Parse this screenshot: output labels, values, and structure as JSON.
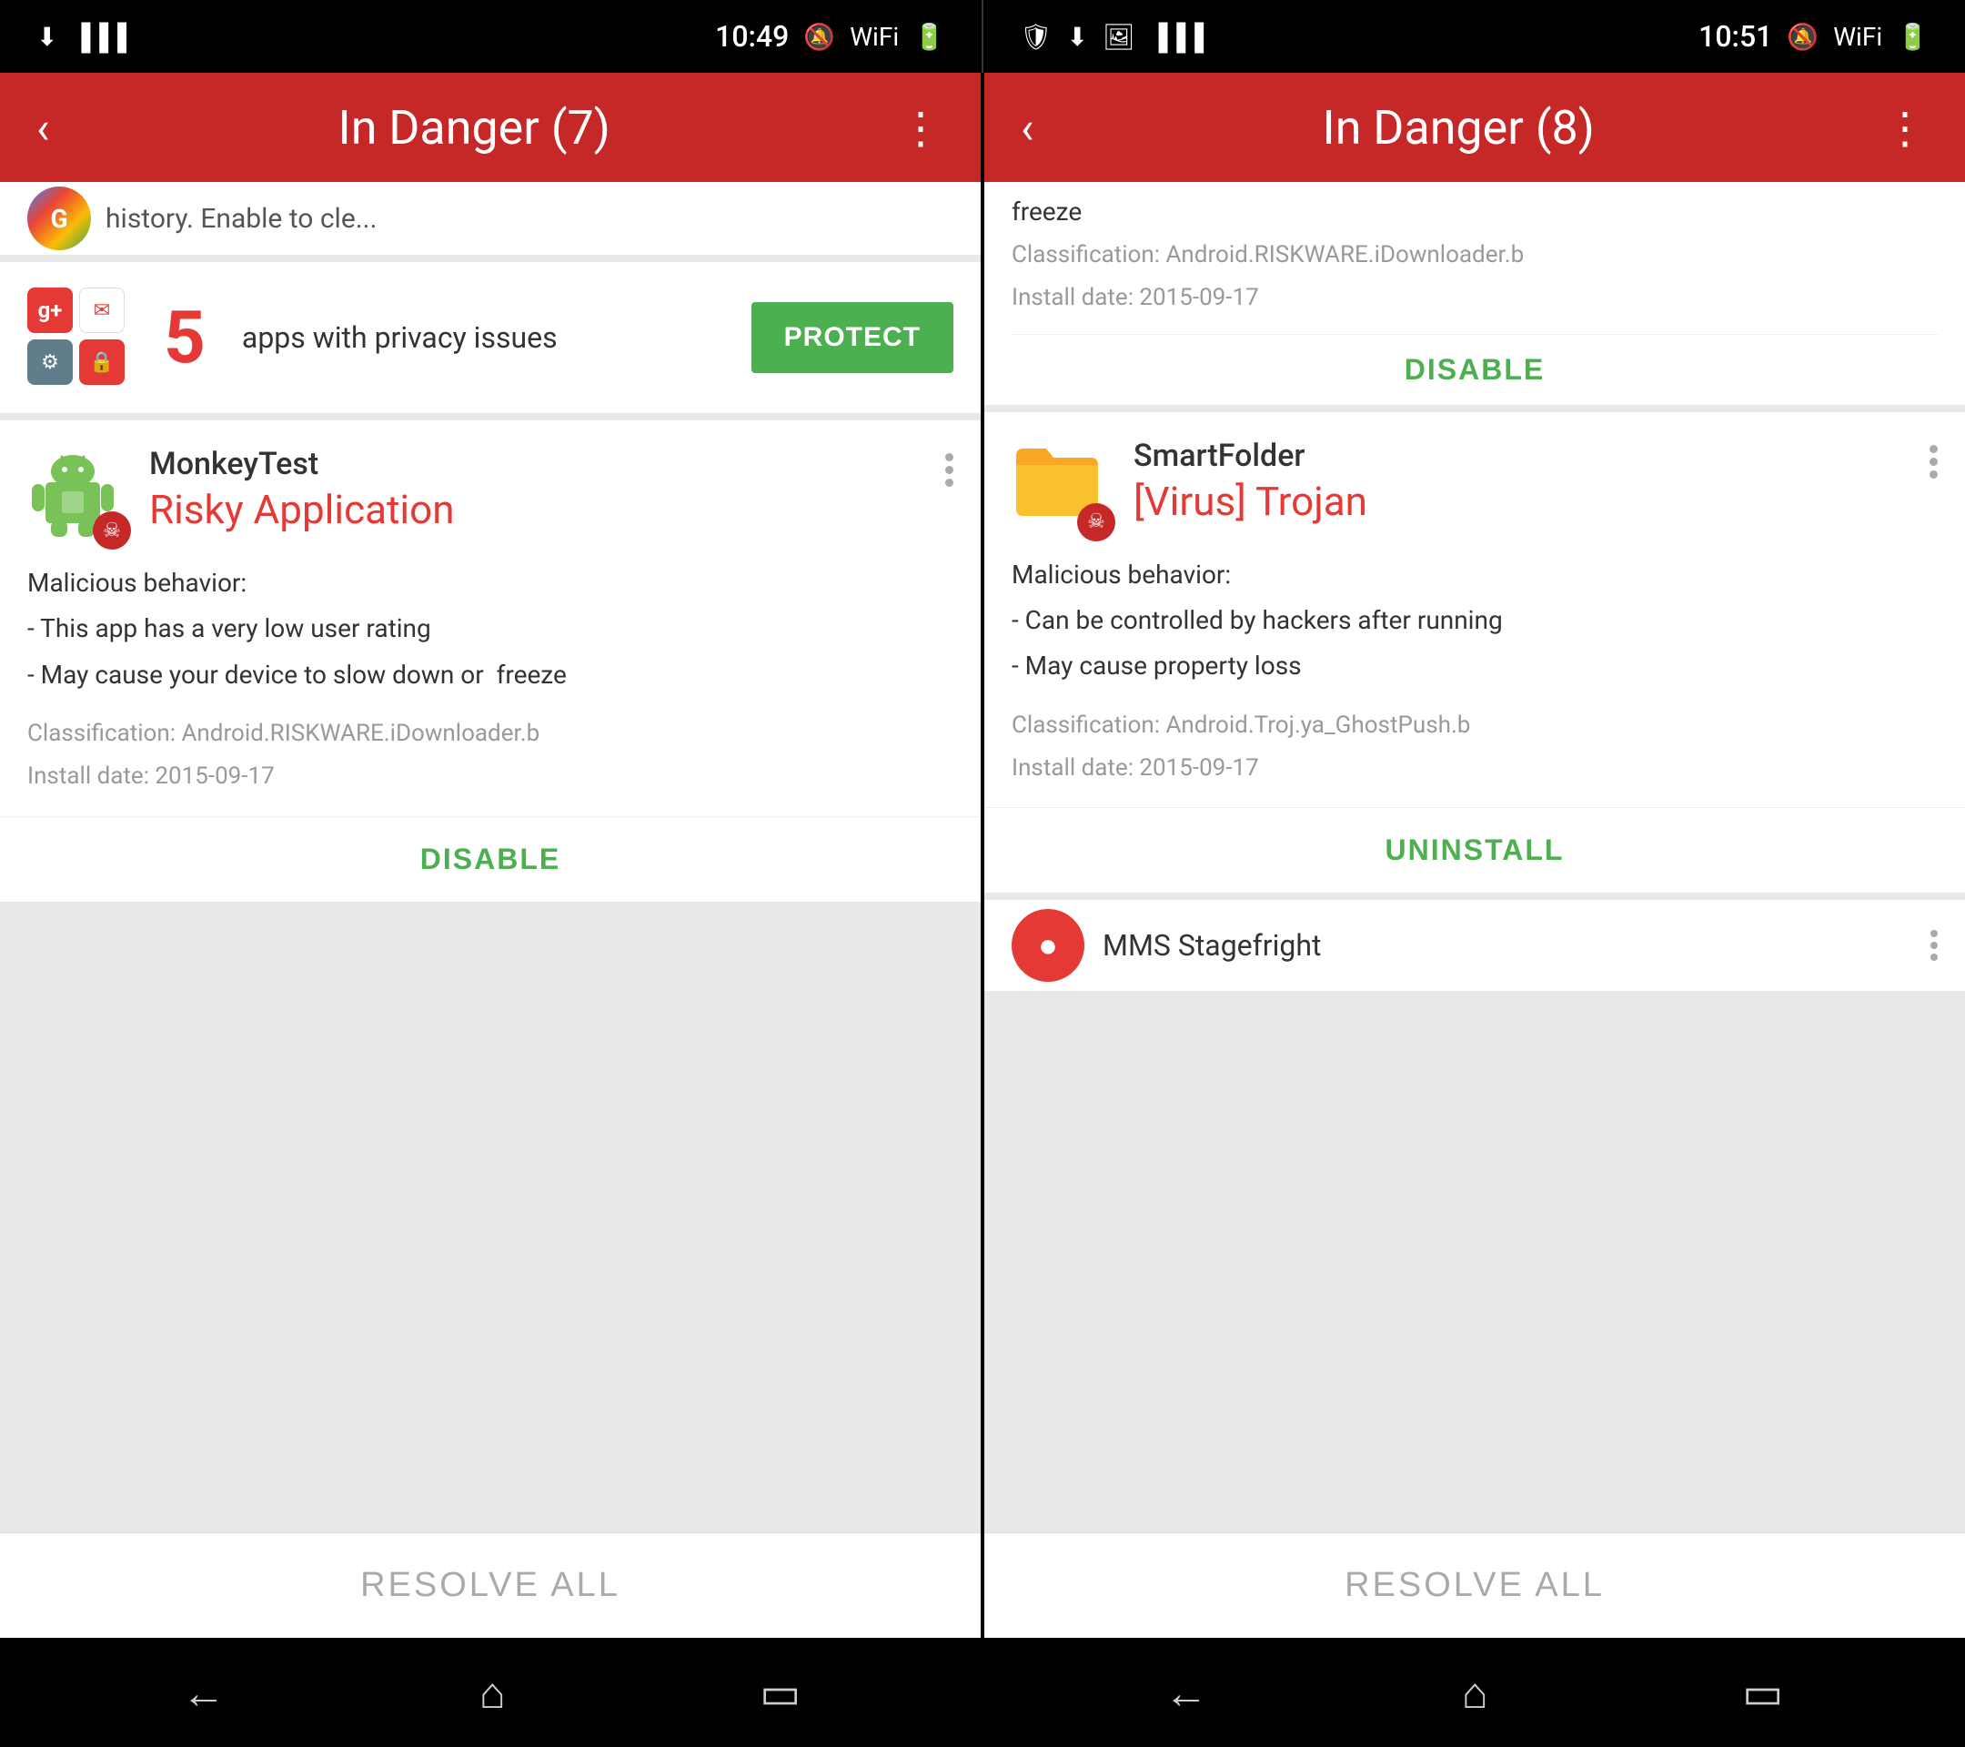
{
  "left_screen": {
    "status_bar": {
      "time": "10:49",
      "icons_left": [
        "notification",
        "bars"
      ],
      "icons_right": [
        "mute",
        "wifi",
        "signal",
        "battery"
      ]
    },
    "header": {
      "title": "In Danger (7)",
      "back_label": "‹",
      "menu_label": "⋮"
    },
    "top_partial": {
      "text": "history. Enable to cle..."
    },
    "privacy_card": {
      "count": "5",
      "text": "apps with privacy issues",
      "protect_label": "PROTECT"
    },
    "threat_card": {
      "app_name": "MonkeyTest",
      "threat_status": "Risky Application",
      "details_title": "Malicious behavior:",
      "details": [
        "This app has a very low user rating",
        "May cause your device to slow down or freeze"
      ],
      "classification_label": "Classification:",
      "classification": "Android.RISKWARE.iDownloader.b",
      "install_label": "Install date:",
      "install_date": "2015-09-17",
      "action_label": "DISABLE"
    },
    "resolve_all": "RESOLVE ALL"
  },
  "right_screen": {
    "status_bar": {
      "time": "10:51",
      "icons_left": [
        "notification",
        "download",
        "image",
        "bars"
      ],
      "icons_right": [
        "mute",
        "wifi",
        "signal",
        "battery"
      ]
    },
    "header": {
      "title": "In Danger (8)",
      "back_label": "‹",
      "menu_label": "⋮"
    },
    "top_partial": {
      "text": "freeze",
      "classification": "Classification: Android.RISKWARE.iDownloader.b",
      "install_date": "Install date: 2015-09-17",
      "action_label": "DISABLE"
    },
    "threat_card": {
      "app_name": "SmartFolder",
      "threat_status": "[Virus] Trojan",
      "details_title": "Malicious behavior:",
      "details": [
        "Can be controlled by hackers after running",
        "May cause property loss"
      ],
      "classification": "Classification: Android.Troj.ya_GhostPush.b",
      "install_date": "Install date: 2015-09-17",
      "action_label": "UNINSTALL"
    },
    "bottom_partial": {
      "text": "MMS Stagefright"
    },
    "resolve_all": "RESOLVE ALL"
  },
  "bottom_nav": {
    "back_icon": "←",
    "home_icon": "⌂",
    "recents_icon": "▭"
  }
}
